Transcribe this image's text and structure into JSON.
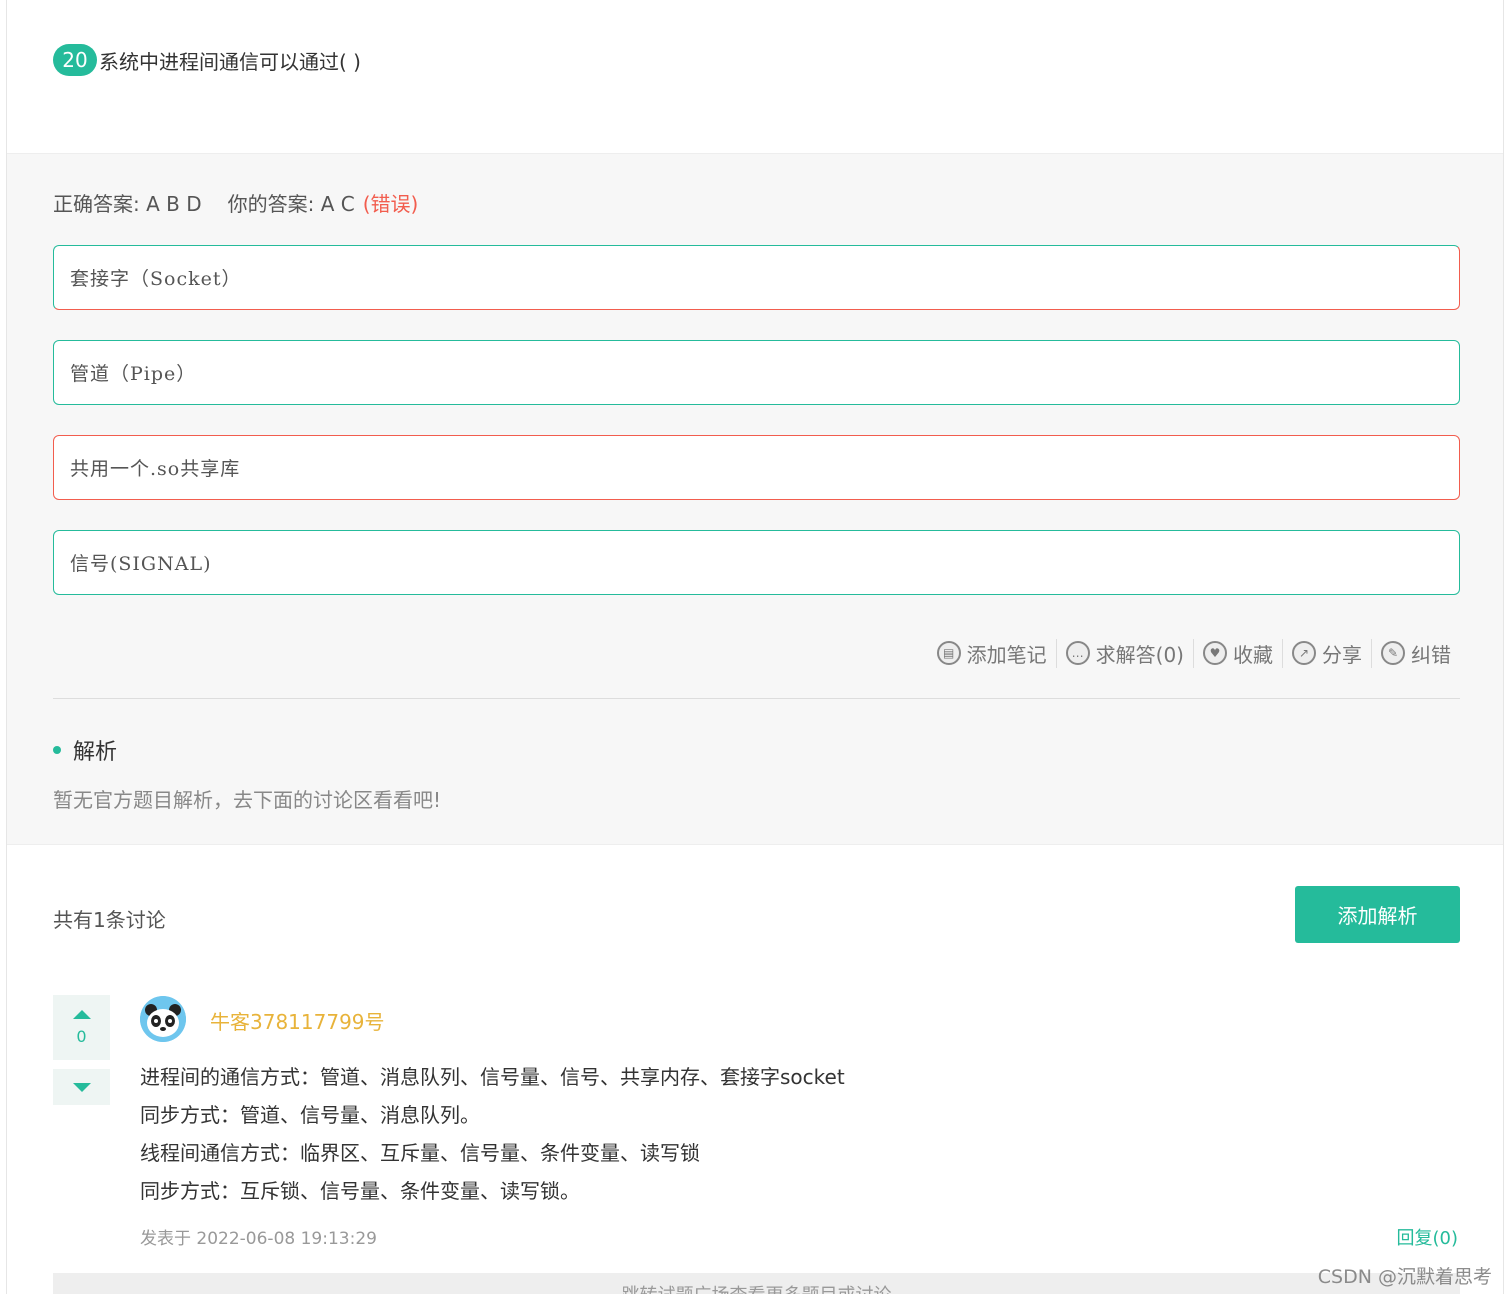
{
  "question": {
    "number": "20",
    "text": "系统中进程间通信可以通过( )"
  },
  "result": {
    "correct_label": "正确答案: A B D",
    "yours_label": "你的答案: A C",
    "status": "(错误)"
  },
  "options": [
    {
      "text": "套接字（Socket）",
      "state": "mixed"
    },
    {
      "text": "管道（Pipe）",
      "state": "correct"
    },
    {
      "text": "共用一个.so共享库",
      "state": "wrong"
    },
    {
      "text": "信号(SIGNAL)",
      "state": "correct"
    }
  ],
  "actions": [
    {
      "label": "添加笔记",
      "icon": "book-icon"
    },
    {
      "label": "求解答(0)",
      "icon": "chat-icon"
    },
    {
      "label": "收藏",
      "icon": "heart-icon"
    },
    {
      "label": "分享",
      "icon": "share-icon"
    },
    {
      "label": "纠错",
      "icon": "pencil-icon"
    }
  ],
  "analysis": {
    "title": "解析",
    "text": "暂无官方题目解析，去下面的讨论区看看吧!"
  },
  "discussion": {
    "count_text": "共有1条讨论",
    "add_button": "添加解析",
    "post": {
      "votes": "0",
      "username": "牛客378117799号",
      "lines": [
        "进程间的通信方式：管道、消息队列、信号量、信号、共享内存、套接字socket",
        "同步方式：管道、信号量、消息队列。",
        "线程间通信方式：临界区、互斥量、信号量、条件变量、读写锁",
        "同步方式：互斥锁、信号量、条件变量、读写锁。"
      ],
      "posted": "发表于 2022-06-08 19:13:29",
      "reply": "回复(0)"
    },
    "more_text": "跳转试题广场查看更多题目或讨论"
  },
  "watermark": "CSDN @沉默着思考",
  "colors": {
    "accent": "#25bb9b",
    "error": "#f25d4e",
    "username": "#e8b33a"
  }
}
